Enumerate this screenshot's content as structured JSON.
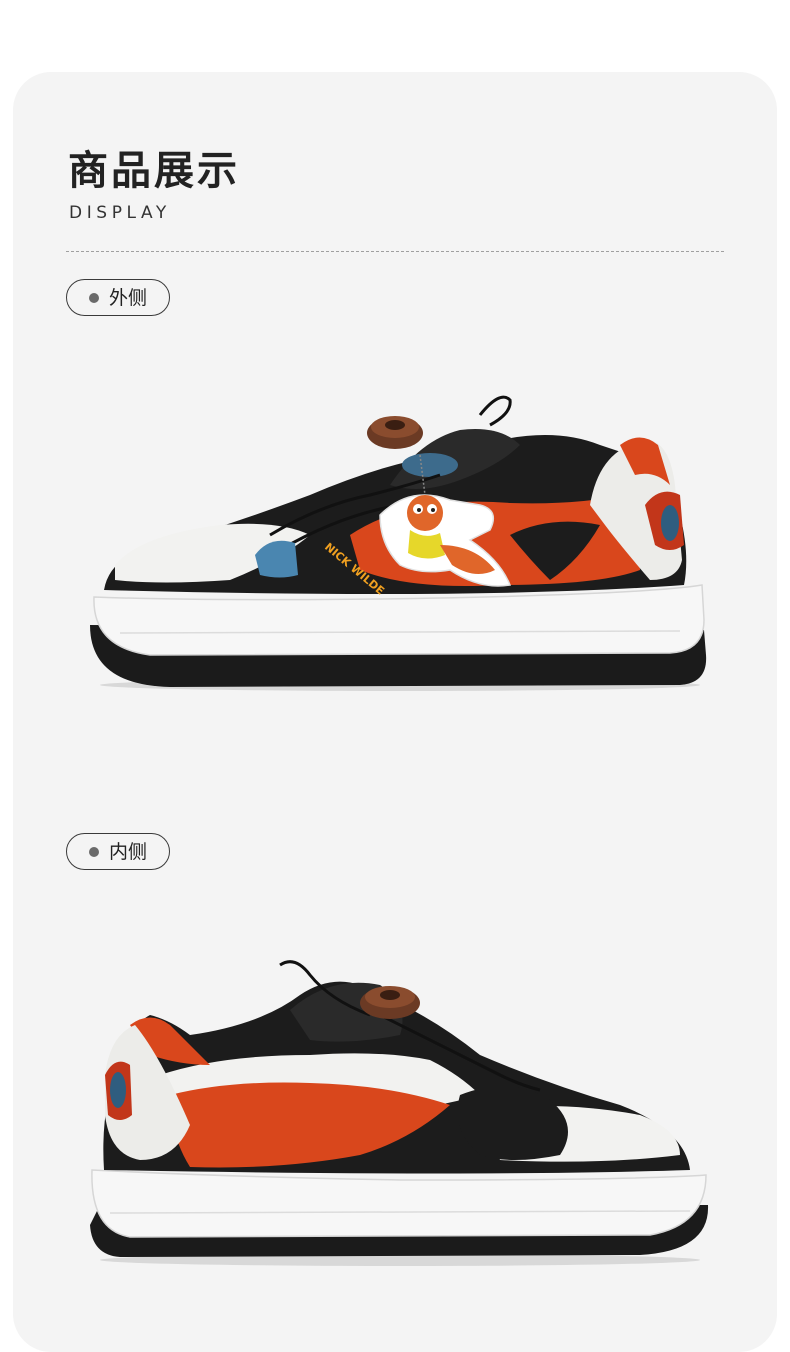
{
  "header": {
    "title": "商品展示",
    "subtitle": "DISPLAY"
  },
  "views": [
    {
      "label": "外侧"
    },
    {
      "label": "内侧"
    }
  ],
  "mascot": {
    "text": "NICK WILDE"
  },
  "colors": {
    "panel_bg": "#f4f4f4",
    "accent_orange": "#d9471c",
    "shoe_black": "#1c1c1c",
    "shoe_white": "#f2f2f0",
    "accent_blue": "#3d7294"
  }
}
